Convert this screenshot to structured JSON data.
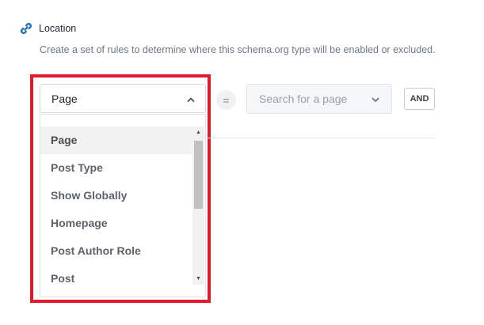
{
  "location": {
    "icon": "link-icon",
    "title": "Location",
    "description": "Create a set of rules to determine where this schema.org type will be enabled or excluded."
  },
  "rule": {
    "type_select": {
      "value": "Page",
      "icon": "chevron-up-icon",
      "expanded": true
    },
    "operator": "=",
    "search_select": {
      "placeholder": "Search for a page",
      "icon": "chevron-down-icon"
    },
    "and_label": "AND"
  },
  "dropdown": {
    "options": [
      "Page",
      "Post Type",
      "Show Globally",
      "Homepage",
      "Post Author Role",
      "Post"
    ],
    "selected": "Page",
    "scroll_position": 0.0
  },
  "colors": {
    "highlight": "#e01b2a",
    "link_icon": "#2271b1"
  }
}
